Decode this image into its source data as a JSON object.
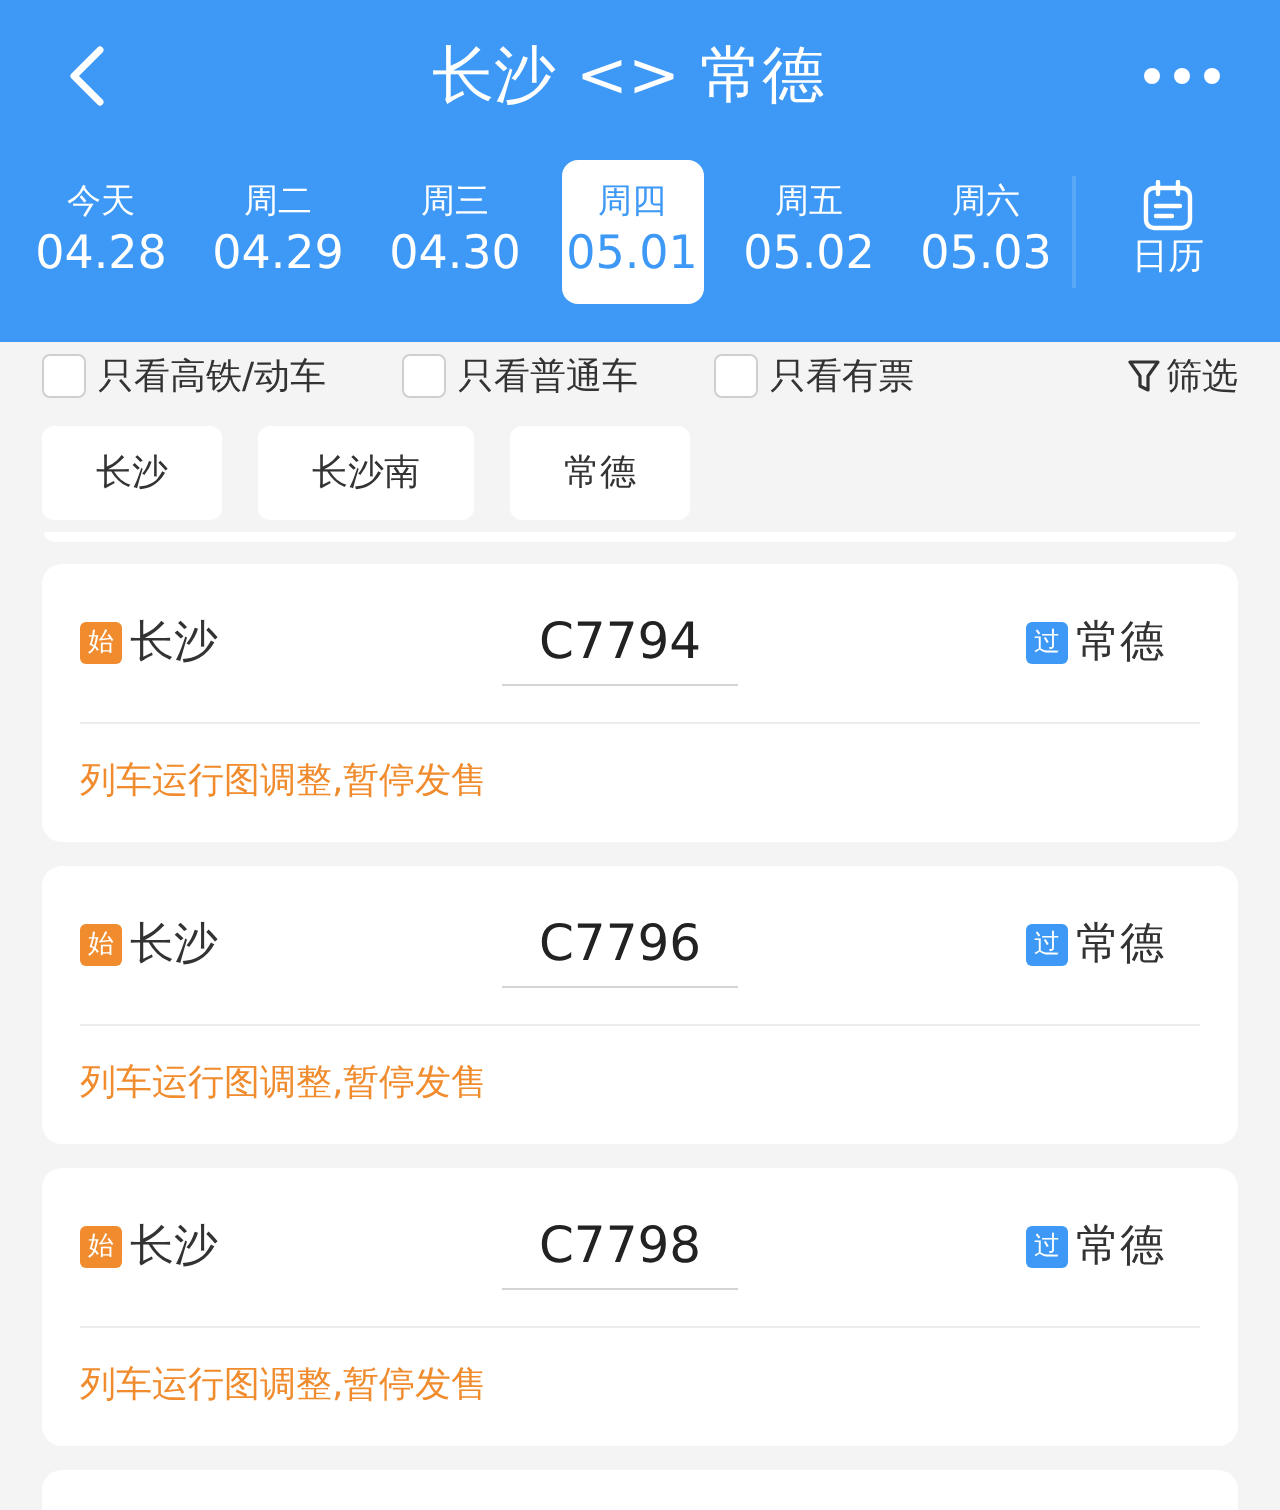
{
  "header": {
    "title": "长沙 <> 常德"
  },
  "dates": [
    {
      "weekday": "今天",
      "date": "04.28",
      "selected": false
    },
    {
      "weekday": "周二",
      "date": "04.29",
      "selected": false
    },
    {
      "weekday": "周三",
      "date": "04.30",
      "selected": false
    },
    {
      "weekday": "周四",
      "date": "05.01",
      "selected": true
    },
    {
      "weekday": "周五",
      "date": "05.02",
      "selected": false
    },
    {
      "weekday": "周六",
      "date": "05.03",
      "selected": false
    }
  ],
  "calendar_button": {
    "label": "日历"
  },
  "filters": [
    {
      "label": "只看高铁/动车",
      "checked": false
    },
    {
      "label": "只看普通车",
      "checked": false
    },
    {
      "label": "只看有票",
      "checked": false
    }
  ],
  "filter_button": {
    "label": "筛选"
  },
  "stations": [
    "长沙",
    "长沙南",
    "常德"
  ],
  "trains": [
    {
      "from_tag": "始",
      "from": "长沙",
      "number": "C7794",
      "to_tag": "过",
      "to": "常德",
      "notice": "列车运行图调整,暂停发售"
    },
    {
      "from_tag": "始",
      "from": "长沙",
      "number": "C7796",
      "to_tag": "过",
      "to": "常德",
      "notice": "列车运行图调整,暂停发售"
    },
    {
      "from_tag": "始",
      "from": "长沙",
      "number": "C7798",
      "to_tag": "过",
      "to": "常德",
      "notice": "列车运行图调整,暂停发售"
    }
  ]
}
